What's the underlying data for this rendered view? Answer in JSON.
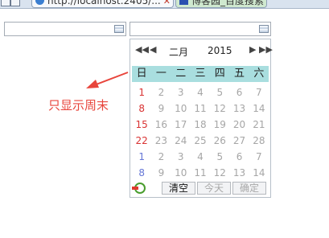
{
  "browser": {
    "active_tab_title": "http://localhost:2405/...",
    "other_tab_title": "博客园_百度搜索"
  },
  "calendar": {
    "month": "二月",
    "year": "2015",
    "weekdays": [
      "日",
      "一",
      "二",
      "三",
      "四",
      "五",
      "六"
    ],
    "weeks": [
      [
        "1",
        "2",
        "3",
        "4",
        "5",
        "6",
        "7"
      ],
      [
        "8",
        "9",
        "10",
        "11",
        "12",
        "13",
        "14"
      ],
      [
        "15",
        "16",
        "17",
        "18",
        "19",
        "20",
        "21"
      ],
      [
        "22",
        "23",
        "24",
        "25",
        "26",
        "27",
        "28"
      ],
      [
        "1",
        "2",
        "3",
        "4",
        "5",
        "6",
        "7"
      ],
      [
        "8",
        "9",
        "10",
        "11",
        "12",
        "13",
        "14"
      ]
    ],
    "clear_label": "清空",
    "today_label": "今天",
    "ok_label": "确定"
  },
  "annotation": {
    "text": "只显示周末",
    "color": "#e8453c"
  },
  "colors": {
    "weekday_header_bg": "#a9dedf",
    "sunday_text": "#d93333",
    "next_month_sunday_text": "#6677d6",
    "disabled_day_text": "#a6a6a6"
  }
}
